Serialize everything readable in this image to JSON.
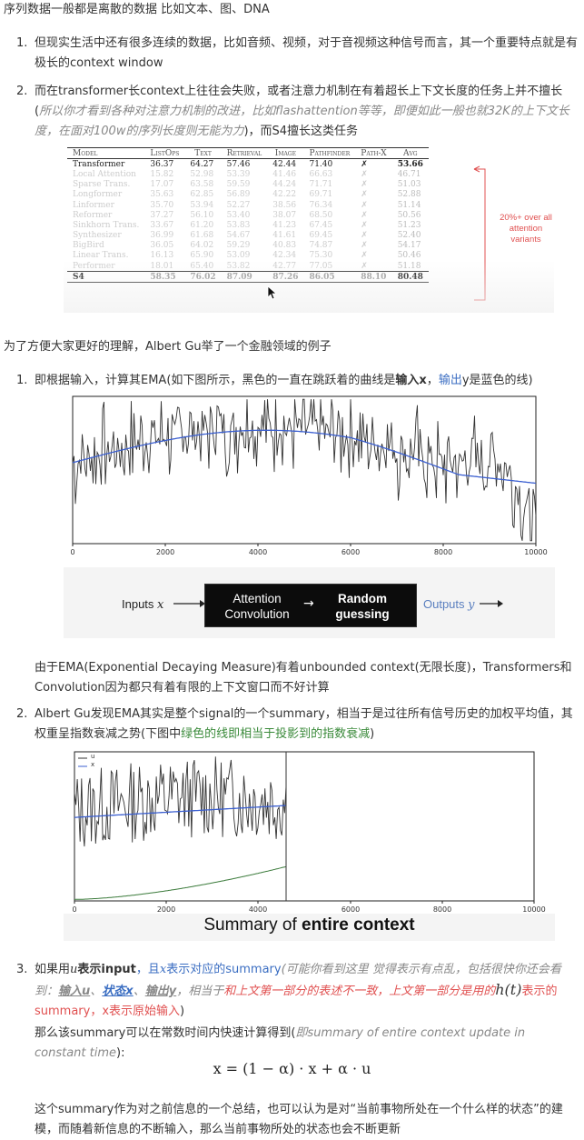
{
  "intro_line": "序列数据一般都是离散的数据 比如文本、图、DNA",
  "list1": [
    {
      "num": "1.",
      "text": "但现实生活中还有很多连续的数据，比如音频、视频，对于音视频这种信号而言，其一个重要特点就是有极长的context window"
    },
    {
      "num": "2.",
      "pre": "而在transformer长context上往往会失败，或者注意力机制在有着超长上下文长度的任务上并不擅长(",
      "italic": "所以你才看到各种对注意力机制的改进，比如flashattention等等，即便如此一般也就32K的上下文长度，在面对100w的序列长度则无能为力",
      "post": ")，而S4擅长这类任务"
    }
  ],
  "s4_table": {
    "headers": [
      "Model",
      "ListOps",
      "Text",
      "Retrieval",
      "Image",
      "Pathfinder",
      "Path-X",
      "Avg"
    ],
    "rows": [
      [
        "Transformer",
        "36.37",
        "64.27",
        "57.46",
        "42.44",
        "71.40",
        "✗",
        "53.66"
      ],
      [
        "Local Attention",
        "15.82",
        "52.98",
        "53.39",
        "41.46",
        "66.63",
        "✗",
        "46.71"
      ],
      [
        "Sparse Trans.",
        "17.07",
        "63.58",
        "59.59",
        "44.24",
        "71.71",
        "✗",
        "51.03"
      ],
      [
        "Longformer",
        "35.63",
        "62.85",
        "56.89",
        "42.22",
        "69.71",
        "✗",
        "52.88"
      ],
      [
        "Linformer",
        "35.70",
        "53.94",
        "52.27",
        "38.56",
        "76.34",
        "✗",
        "51.14"
      ],
      [
        "Reformer",
        "37.27",
        "56.10",
        "53.40",
        "38.07",
        "68.50",
        "✗",
        "50.56"
      ],
      [
        "Sinkhorn Trans.",
        "33.67",
        "61.20",
        "53.83",
        "41.23",
        "67.45",
        "✗",
        "51.23"
      ],
      [
        "Synthesizer",
        "36.99",
        "61.68",
        "54.67",
        "41.61",
        "69.45",
        "✗",
        "52.40"
      ],
      [
        "BigBird",
        "36.05",
        "64.02",
        "59.29",
        "40.83",
        "74.87",
        "✗",
        "54.17"
      ],
      [
        "Linear Trans.",
        "16.13",
        "65.90",
        "53.09",
        "42.34",
        "75.30",
        "✗",
        "50.46"
      ],
      [
        "Performer",
        "18.01",
        "65.40",
        "53.82",
        "42.77",
        "77.05",
        "✗",
        "51.18"
      ]
    ],
    "last_row": [
      "S4",
      "58.35",
      "76.02",
      "87.09",
      "87.26",
      "86.05",
      "88.10",
      "80.48"
    ],
    "annotation": "20%+ over all attention variants",
    "annotation_color": "#e05050"
  },
  "para2": "为了方便大家更好的理解，Albert Gu举了一个金融领域的例子",
  "list2": [
    {
      "num": "1.",
      "pre": "即根据输入，计算其EMA(如下图所示，黑色的一直在跳跃着的曲线是",
      "bold": "输入x",
      "mid": "，",
      "blue": "输出",
      "post": "y是蓝色的线)"
    }
  ],
  "fig1": {
    "x_ticks": [
      "0",
      "2000",
      "4000",
      "6000",
      "8000",
      "10000"
    ],
    "inputs_label": "Inputs",
    "inputs_var": "x",
    "box_left": "Attention\nConvolution",
    "box_left_1": "Attention",
    "box_left_2": "Convolution",
    "arrow": "→",
    "box_right_1": "Random",
    "box_right_2": "guessing",
    "outputs_label": "Outputs",
    "outputs_var": "y"
  },
  "fig1_note": "由于EMA(Exponential Decaying Measure)有着unbounded context(无限长度)，Transformers和Convolution因为都只有着有限的上下文窗口而不好计算",
  "list3": [
    {
      "num": "2.",
      "pre": "Albert Gu发现EMA其实是整个signal的一个summary，相当于是过往所有信号历史的加权平均值，其权重呈指数衰减之势(下图中",
      "green": "绿色的线即相当于投影到的指数衰减",
      "post": ")"
    }
  ],
  "fig2": {
    "legend_u": "u",
    "legend_x": "x",
    "x_ticks": [
      "0",
      "2000",
      "4000",
      "6000",
      "8000",
      "10000"
    ],
    "caption_pre": "Summary of ",
    "caption_bold": "entire context"
  },
  "list4": {
    "num": "3.",
    "p1": "如果用",
    "u": "u",
    "p2": "表示input",
    "p3": "，且",
    "x": "x",
    "p4": "表示对应的summary",
    "p5": "(可能你看到这里 觉得表示有点乱，包括很快你还会看到：",
    "s1": "输入u",
    "sep1": "、",
    "s2": "状态x",
    "sep2": "、",
    "s3": "输出y",
    "p6": "，相当于",
    "p7": "和上文第一部分的表述不一致，上文第一部分是用的",
    "h": "h(t)",
    "p8": "表示的summary，x表示原始输入",
    "p9": ")",
    "l2": "那么该summary可以在常数时间内快速计算得到(",
    "l2i": "即summary of entire context update in constant time",
    "l2e": "):",
    "formula": "x = (1 − α) · x + α · u",
    "l3": "这个summary作为对之前信息的一个总结，也可以认为是对“当前事物所处在一个什么样的状态”的建模，而随着新信息的不断输入，那么当前事物所处的状态也会不断更新"
  }
}
